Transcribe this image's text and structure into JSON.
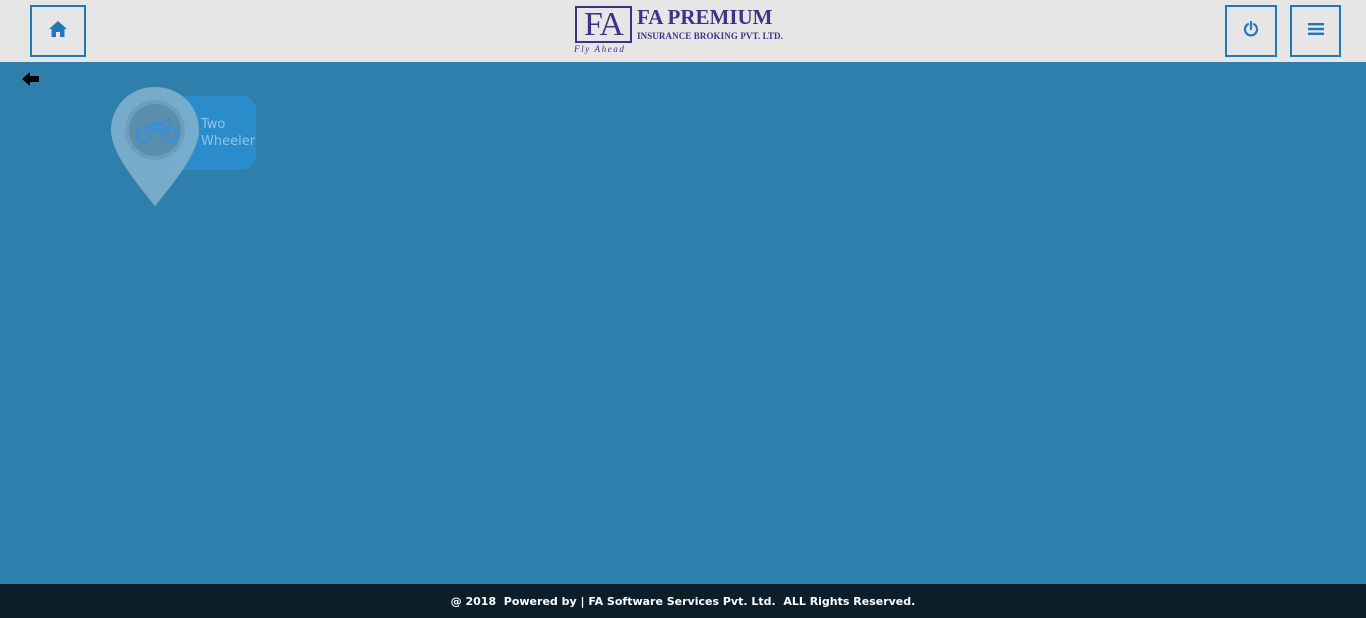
{
  "header": {
    "home_icon": "home-icon",
    "power_icon": "power-icon",
    "menu_icon": "hamburger-menu-icon",
    "accent_color": "#2378b6",
    "background_color": "#e6e6e6"
  },
  "logo": {
    "mark": "FA",
    "title": "FA PREMIUM",
    "subtitle": "INSURANCE BROKING PVT. LTD.",
    "tagline": "Fly Ahead",
    "color": "#3f3285"
  },
  "nav": {
    "back_icon": "arrow-left-icon"
  },
  "tiles": [
    {
      "label_line1": "Two",
      "label_line2": "Wheeler",
      "icon": "motorcycle-icon"
    }
  ],
  "main": {
    "background_color": "#2e7fab"
  },
  "footer": {
    "text": "@ 2018  Powered by | FA Software Services Pvt. Ltd.  ALL Rights Reserved.",
    "background_color": "#0c1e29"
  }
}
